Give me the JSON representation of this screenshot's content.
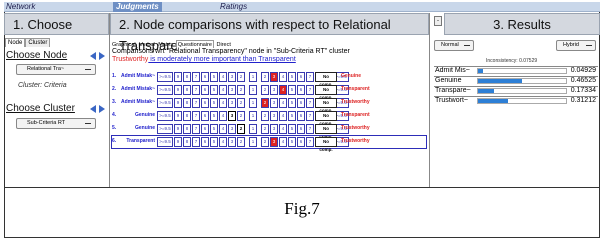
{
  "menubar": {
    "items": [
      {
        "label": "Network",
        "active": false
      },
      {
        "label": "Judgments",
        "active": true
      },
      {
        "label": "Ratings",
        "active": false
      }
    ]
  },
  "choose": {
    "header": "1. Choose",
    "tabs": [
      "Node",
      "Cluster"
    ],
    "node_title": "Choose Node",
    "node_select": "Relational Tra~",
    "cluster_label": "Cluster: Criteria",
    "cluster_title": "Choose Cluster",
    "cluster_select": "Sub-Criteria RT"
  },
  "comparisons": {
    "header": "2. Node comparisons with respect to Relational Transpare~",
    "tabs": [
      "Graphical",
      "Verbal",
      "Matrix",
      "Questionnaire",
      "Direct"
    ],
    "active_tab": "Questionnaire",
    "description": "Comparisons wrt \"Relational Transparency\" node in \"Sub-Criteria RT\" cluster",
    "statement_red": "Trustworthy",
    "statement_blue": " is moderately more important than Transparent",
    "scale_left": [
      ">=9.5",
      "9",
      "8",
      "7",
      "6",
      "5",
      "4",
      "3",
      "2"
    ],
    "scale_right": [
      "2",
      "3",
      "4",
      "5",
      "6",
      "7",
      "8",
      "9",
      ">=9.5"
    ],
    "center": "1",
    "no_comp_label": "No comp.",
    "rows": [
      {
        "num": "1.",
        "left": "Admit Mistak~",
        "right": "Genuine",
        "choice": "R3",
        "selected": false
      },
      {
        "num": "2.",
        "left": "Admit Mistak~",
        "right": "Transparent",
        "choice": "R4",
        "selected": false
      },
      {
        "num": "3.",
        "left": "Admit Mistak~",
        "right": "Trustworthy",
        "choice": "R2",
        "selected": false
      },
      {
        "num": "4.",
        "left": "Genuine",
        "right": "Transparent",
        "choice": "L3",
        "selected": false
      },
      {
        "num": "5.",
        "left": "Genuine",
        "right": "Trustworthy",
        "choice": "L2",
        "selected": false
      },
      {
        "num": "6.",
        "left": "Transparent",
        "right": "Trustworthy",
        "choice": "R3",
        "selected": true
      }
    ]
  },
  "results": {
    "header": "3. Results",
    "close_label": "-",
    "mode_select": "Normal",
    "display_select": "Hybrid",
    "inconsistency": "Inconsistency: 0.07529",
    "rows": [
      {
        "name": "Admit Mis~",
        "value": "0.04929",
        "fraction": 0.106
      },
      {
        "name": "Genuine",
        "value": "0.46525",
        "fraction": 1.0
      },
      {
        "name": "Transpare~",
        "value": "0.17334",
        "fraction": 0.373
      },
      {
        "name": "Trustwort~",
        "value": "0.31212",
        "fraction": 0.671
      }
    ]
  },
  "caption": "Fig.7"
}
